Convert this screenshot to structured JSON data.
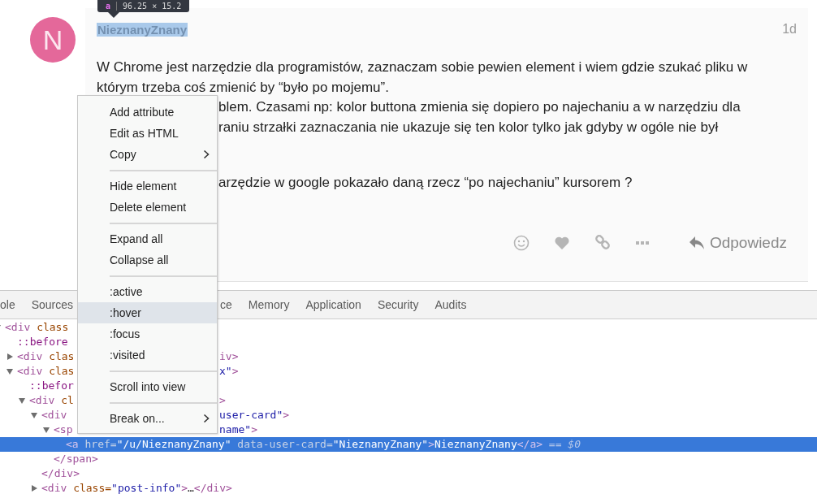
{
  "tooltip": {
    "tag": "a",
    "size": "96.25 × 15.2"
  },
  "post": {
    "avatar_letter": "N",
    "username": {
      "text": "NieznanyZnany",
      "highlighted": true
    },
    "age": "1d",
    "paragraphs": [
      {
        "lines": [
          {
            "kind": "full",
            "text": "W Chrome jest narzędzie dla programistów, zaznaczam sobie pewien element i wiem gdzie szukać pliku w"
          },
          {
            "kind": "full",
            "text": "którym trzeba coś zmienić by “było po mojemu”."
          },
          {
            "kind": "covered",
            "text": "blem. Czasami np: kolor buttona zmienia się dopiero po najechaniu a w narzędziu dla"
          },
          {
            "kind": "covered",
            "text": "raniu strzałki zaznaczania nie ukazuje się ten kolor tylko jak gdyby w ogóle nie był"
          }
        ]
      },
      {
        "lines": [
          {
            "kind": "covered",
            "text": "arzędzie w google pokazało daną rzecz “po najechaniu” kursorem ?"
          }
        ]
      }
    ],
    "actions": [
      {
        "kind": "emoji"
      },
      {
        "kind": "like"
      },
      {
        "kind": "link"
      },
      {
        "kind": "more"
      }
    ],
    "reply": "Odpowiedz"
  },
  "devtools": {
    "tabs": [
      {
        "label": "ole",
        "selected": false
      },
      {
        "label": "Sources",
        "selected": false
      },
      {
        "label": "ce",
        "selected": false
      },
      {
        "label": "Memory",
        "selected": false
      },
      {
        "label": "Application",
        "selected": false
      },
      {
        "label": "Security",
        "selected": false
      },
      {
        "label": "Audits",
        "selected": false
      }
    ],
    "tree": [
      {
        "expanded": true,
        "selected": false,
        "left": [
          {
            "kind": "tag",
            "text": "<div "
          },
          {
            "kind": "attr",
            "text": "class"
          }
        ],
        "children": [
          {
            "selected": false,
            "left": [
              {
                "kind": "pseudo",
                "text": "::before"
              }
            ]
          },
          {
            "expanded": false,
            "selected": false,
            "left": [
              {
                "kind": "tag",
                "text": "<div "
              },
              {
                "kind": "attr",
                "text": "clas"
              }
            ],
            "right": [
              {
                "kind": "tag",
                "text": "iv>"
              }
            ]
          },
          {
            "expanded": true,
            "selected": false,
            "left": [
              {
                "kind": "tag",
                "text": "<div "
              },
              {
                "kind": "attr",
                "text": "clas"
              }
            ],
            "right": [
              {
                "kind": "value",
                "text": "x\""
              },
              {
                "kind": "tag",
                "text": ">"
              }
            ],
            "children": [
              {
                "selected": false,
                "left": [
                  {
                    "kind": "pseudo",
                    "text": "::befor"
                  }
                ]
              },
              {
                "expanded": true,
                "selected": false,
                "left": [
                  {
                    "kind": "tag",
                    "text": "<div "
                  },
                  {
                    "kind": "attr",
                    "text": "cl"
                  }
                ],
                "right": [
                  {
                    "kind": "tag",
                    "text": ">"
                  }
                ],
                "children": [
                  {
                    "expanded": true,
                    "selected": false,
                    "left": [
                      {
                        "kind": "tag",
                        "text": "<div"
                      }
                    ],
                    "right": [
                      {
                        "kind": "value",
                        "text": "user-card\""
                      },
                      {
                        "kind": "tag",
                        "text": ">"
                      }
                    ],
                    "children": [
                      {
                        "expanded": true,
                        "selected": false,
                        "left": [
                          {
                            "kind": "tag",
                            "text": "<sp"
                          }
                        ],
                        "right": [
                          {
                            "kind": "value",
                            "text": "name\""
                          },
                          {
                            "kind": "tag",
                            "text": ">"
                          }
                        ],
                        "children": [
                          {
                            "selected": true,
                            "left": [
                              {
                                "kind": "tag",
                                "text": "<a "
                              },
                              {
                                "kind": "attr",
                                "text": "href="
                              },
                              {
                                "kind": "value",
                                "text": "\"/u/NieznanyZnany\""
                              },
                              {
                                "kind": "attr",
                                "text": " data-user-card="
                              },
                              {
                                "kind": "value",
                                "text": "\"NieznanyZnany\""
                              },
                              {
                                "kind": "tag",
                                "text": ">"
                              },
                              {
                                "kind": "content",
                                "text": "NieznanyZnany"
                              },
                              {
                                "kind": "tag",
                                "text": "</a>"
                              },
                              {
                                "kind": "marker",
                                "text": " == $0"
                              }
                            ]
                          }
                        ],
                        "close": [
                          {
                            "kind": "tag",
                            "text": "</span>"
                          }
                        ]
                      }
                    ],
                    "close": [
                      {
                        "kind": "tag",
                        "text": "</div>"
                      }
                    ]
                  },
                  {
                    "expanded": false,
                    "selected": false,
                    "left": [
                      {
                        "kind": "tag",
                        "text": "<div "
                      },
                      {
                        "kind": "attr",
                        "text": "class="
                      },
                      {
                        "kind": "value",
                        "text": "\"post-info\""
                      },
                      {
                        "kind": "tag",
                        "text": ">"
                      },
                      {
                        "kind": "content",
                        "text": "…"
                      },
                      {
                        "kind": "tag",
                        "text": "</div>"
                      }
                    ]
                  }
                ]
              }
            ]
          }
        ]
      }
    ]
  },
  "context_menu": [
    {
      "kind": "item",
      "label": "Add attribute",
      "submenu": false,
      "highlighted": false
    },
    {
      "kind": "item",
      "label": "Edit as HTML",
      "submenu": false,
      "highlighted": false
    },
    {
      "kind": "item",
      "label": "Copy",
      "submenu": true,
      "highlighted": false
    },
    {
      "kind": "separator"
    },
    {
      "kind": "item",
      "label": "Hide element",
      "submenu": false,
      "highlighted": false
    },
    {
      "kind": "item",
      "label": "Delete element",
      "submenu": false,
      "highlighted": false
    },
    {
      "kind": "separator"
    },
    {
      "kind": "item",
      "label": "Expand all",
      "submenu": false,
      "highlighted": false
    },
    {
      "kind": "item",
      "label": "Collapse all",
      "submenu": false,
      "highlighted": false
    },
    {
      "kind": "separator"
    },
    {
      "kind": "item",
      "label": ":active",
      "submenu": false,
      "highlighted": false
    },
    {
      "kind": "item",
      "label": ":hover",
      "submenu": false,
      "highlighted": true
    },
    {
      "kind": "item",
      "label": ":focus",
      "submenu": false,
      "highlighted": false
    },
    {
      "kind": "item",
      "label": ":visited",
      "submenu": false,
      "highlighted": false
    },
    {
      "kind": "separator"
    },
    {
      "kind": "item",
      "label": "Scroll into view",
      "submenu": false,
      "highlighted": false
    },
    {
      "kind": "separator"
    },
    {
      "kind": "item",
      "label": "Break on...",
      "submenu": true,
      "highlighted": false
    }
  ]
}
